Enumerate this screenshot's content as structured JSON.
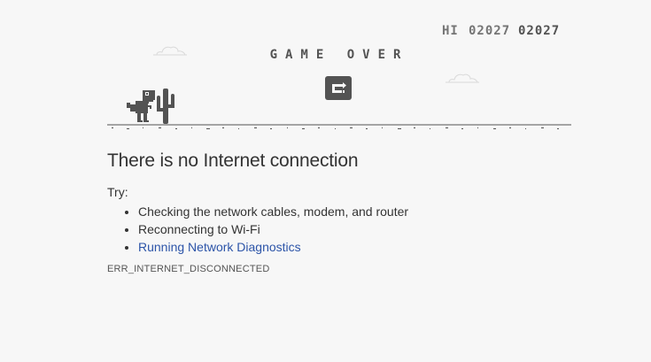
{
  "game": {
    "hi_label": "HI",
    "hi_score": "02027",
    "current_score": "02027",
    "game_over_text": "GAME OVER",
    "restart_icon": "restart-icon",
    "colors": {
      "ink": "#535353",
      "ink_light": "#757575",
      "background": "#f7f7f7"
    }
  },
  "message": {
    "title": "There is no Internet connection",
    "try_label": "Try:",
    "suggestions": [
      "Checking the network cables, modem, and router",
      "Reconnecting to Wi-Fi"
    ],
    "diagnostics_link": "Running Network Diagnostics",
    "error_code": "ERR_INTERNET_DISCONNECTED",
    "link_color": "#2c54a8"
  }
}
